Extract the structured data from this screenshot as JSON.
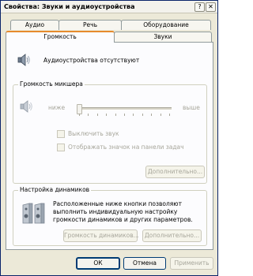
{
  "window": {
    "title": "Свойства: Звуки и аудиоустройства",
    "help_symbol": "?",
    "close_symbol": "✕"
  },
  "tabs": {
    "row_back": [
      "Аудио",
      "Речь",
      "Оборудование"
    ],
    "row_front": [
      "Громкость",
      "Звуки"
    ],
    "selected": "Громкость"
  },
  "device": {
    "status_text": "Аудиоустройства отсутствуют",
    "icon": "speaker-icon"
  },
  "mixer": {
    "group_label": "Громкость микшера",
    "low_label": "ниже",
    "high_label": "выше",
    "volume_level": 0.0,
    "mute_label": "Выключить звук",
    "mute_checked": false,
    "tray_icon_label": "Отображать значок на панели задач",
    "tray_icon_checked": false,
    "advanced_button": "Дополнительно..."
  },
  "speakers": {
    "group_label": "Настройка динамиков",
    "description": "Расположенные ниже кнопки позволяют выполнить индивидуальную настройку громкости динамиков и других параметров.",
    "speaker_volume_button": "Громкость динамиков...",
    "advanced_button": "Дополнительно..."
  },
  "footer": {
    "ok": "ОК",
    "cancel": "Отмена",
    "apply": "Применить"
  }
}
